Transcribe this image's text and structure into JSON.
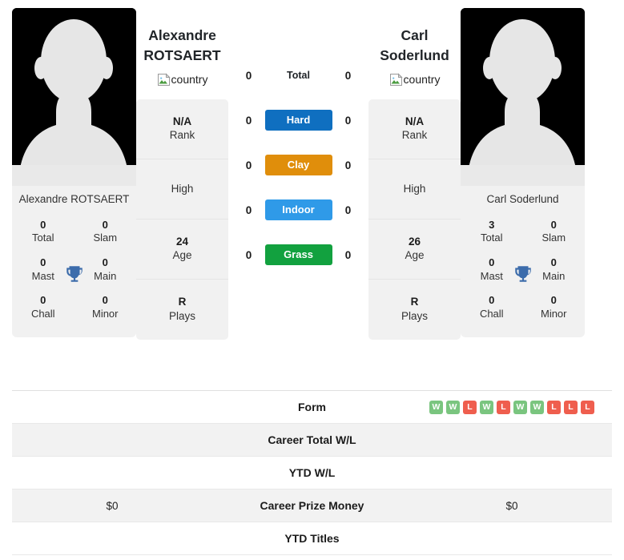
{
  "players": {
    "left": {
      "first_name": "Alexandre",
      "last_name": "ROTSAERT",
      "card_name": "Alexandre ROTSAERT",
      "country_alt": "country",
      "rank": "N/A",
      "rank_label": "Rank",
      "high_value": "",
      "high_label": "High",
      "age": "24",
      "age_label": "Age",
      "plays": "R",
      "plays_label": "Plays",
      "titles": {
        "total": "0",
        "total_label": "Total",
        "slam": "0",
        "slam_label": "Slam",
        "mast": "0",
        "mast_label": "Mast",
        "main": "0",
        "main_label": "Main",
        "chall": "0",
        "chall_label": "Chall",
        "minor": "0",
        "minor_label": "Minor"
      },
      "h2h": {
        "total": "0",
        "hard": "0",
        "clay": "0",
        "indoor": "0",
        "grass": "0"
      },
      "form": [],
      "career_total_wl": "",
      "ytd_wl": "",
      "career_prize_money": "$0",
      "ytd_titles": ""
    },
    "right": {
      "first_name": "Carl",
      "last_name": "Soderlund",
      "card_name": "Carl Soderlund",
      "country_alt": "country",
      "rank": "N/A",
      "rank_label": "Rank",
      "high_value": "",
      "high_label": "High",
      "age": "26",
      "age_label": "Age",
      "plays": "R",
      "plays_label": "Plays",
      "titles": {
        "total": "3",
        "total_label": "Total",
        "slam": "0",
        "slam_label": "Slam",
        "mast": "0",
        "mast_label": "Mast",
        "main": "0",
        "main_label": "Main",
        "chall": "0",
        "chall_label": "Chall",
        "minor": "0",
        "minor_label": "Minor"
      },
      "h2h": {
        "total": "0",
        "hard": "0",
        "clay": "0",
        "indoor": "0",
        "grass": "0"
      },
      "form": [
        "W",
        "W",
        "L",
        "W",
        "L",
        "W",
        "W",
        "L",
        "L",
        "L"
      ],
      "career_total_wl": "",
      "ytd_wl": "",
      "career_prize_money": "$0",
      "ytd_titles": ""
    }
  },
  "surfaces": [
    {
      "key": "total",
      "label": "Total",
      "styled": false,
      "color": ""
    },
    {
      "key": "hard",
      "label": "Hard",
      "styled": true,
      "color": "#0f6fc0"
    },
    {
      "key": "clay",
      "label": "Clay",
      "styled": true,
      "color": "#e08e0b"
    },
    {
      "key": "indoor",
      "label": "Indoor",
      "styled": true,
      "color": "#2f9ae8"
    },
    {
      "key": "grass",
      "label": "Grass",
      "styled": true,
      "color": "#12a13f"
    }
  ],
  "table_rows": [
    {
      "key": "form",
      "label": "Form"
    },
    {
      "key": "career_total_wl",
      "label": "Career Total W/L"
    },
    {
      "key": "ytd_wl",
      "label": "YTD W/L"
    },
    {
      "key": "career_prize_money",
      "label": "Career Prize Money"
    },
    {
      "key": "ytd_titles",
      "label": "YTD Titles"
    }
  ],
  "colors": {
    "win_badge": "#7ac57f",
    "loss_badge": "#ef5e4e",
    "trophy": "#3c6cab",
    "panel_bg": "#f1f1f1",
    "row_shade": "#f2f2f2"
  },
  "icons": {
    "trophy": "trophy-icon",
    "broken_image": "broken-image-icon",
    "avatar": "player-avatar-silhouette"
  }
}
